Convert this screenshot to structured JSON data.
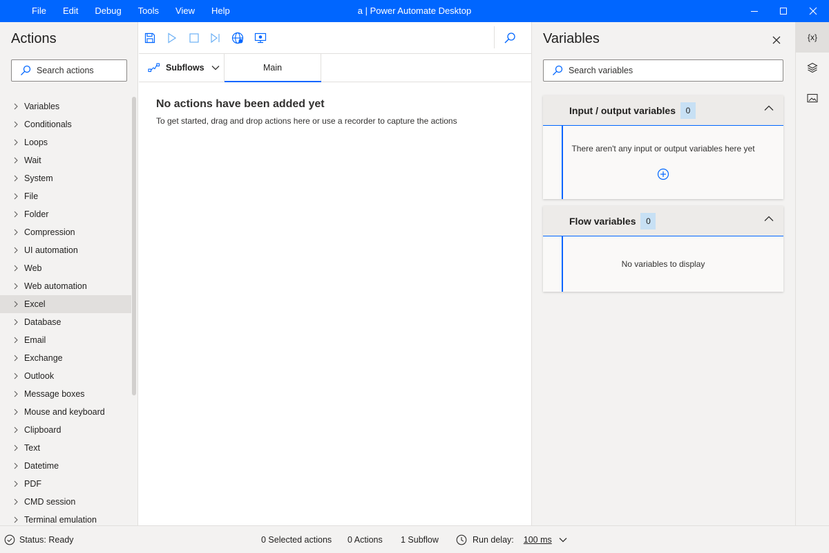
{
  "window": {
    "title": "a | Power Automate Desktop",
    "menu": [
      "File",
      "Edit",
      "Debug",
      "Tools",
      "View",
      "Help"
    ],
    "controls": [
      "minimize-icon",
      "maximize-icon",
      "close-icon"
    ],
    "accent": "#0066ff"
  },
  "actions": {
    "title": "Actions",
    "search_placeholder": "Search actions",
    "items": [
      "Variables",
      "Conditionals",
      "Loops",
      "Wait",
      "System",
      "File",
      "Folder",
      "Compression",
      "UI automation",
      "Web",
      "Web automation",
      "Excel",
      "Database",
      "Email",
      "Exchange",
      "Outlook",
      "Message boxes",
      "Mouse and keyboard",
      "Clipboard",
      "Text",
      "Datetime",
      "PDF",
      "CMD session",
      "Terminal emulation"
    ],
    "highlighted": "Excel"
  },
  "designer": {
    "toolbar": [
      "save-icon",
      "run-icon",
      "stop-icon",
      "run-next-action-icon",
      "web-recorder-icon",
      "desktop-recorder-icon",
      "search-icon"
    ],
    "subflows_label": "Subflows",
    "tab_main": "Main",
    "empty_title": "No actions have been added yet",
    "empty_text": "To get started, drag and drop actions here or use a recorder to capture the actions"
  },
  "variables": {
    "title": "Variables",
    "search_placeholder": "Search variables",
    "io": {
      "label": "Input / output variables",
      "count": "0",
      "empty": "There aren't any input or output variables here yet"
    },
    "flow": {
      "label": "Flow variables",
      "count": "0",
      "empty": "No variables to display"
    }
  },
  "rail": {
    "variables_button": "{x}",
    "items": [
      "variables-icon",
      "ui-elements-icon",
      "images-icon"
    ]
  },
  "status": {
    "state": "Status: Ready",
    "selected": "0 Selected actions",
    "actions": "0 Actions",
    "subflows": "1 Subflow",
    "delay_label": "Run delay:",
    "delay_value": "100 ms"
  }
}
